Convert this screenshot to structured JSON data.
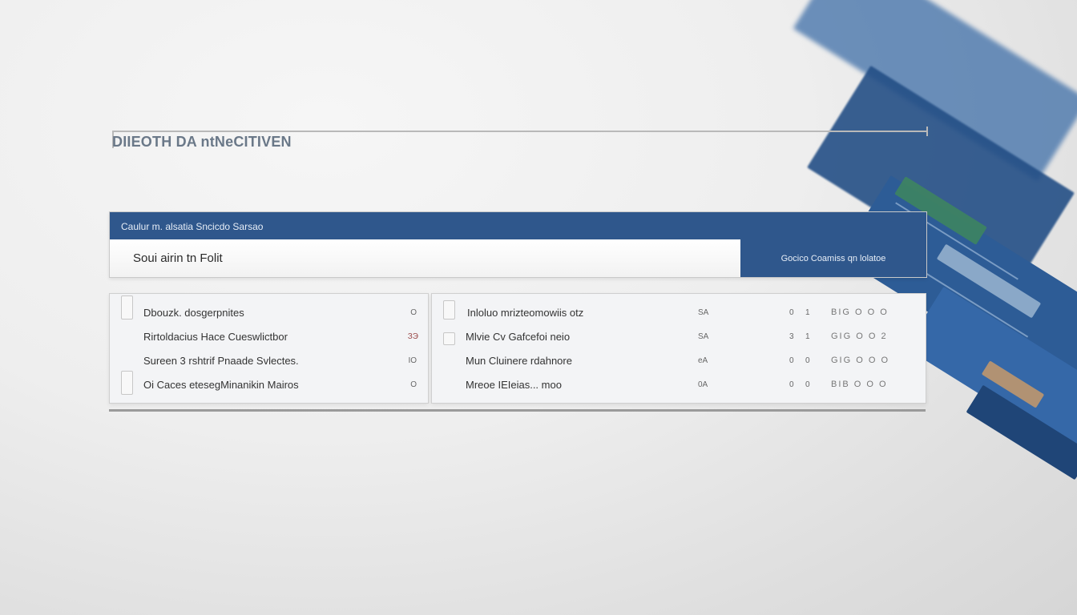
{
  "header": {
    "title": "DIIEOTH DA ntNeCITIVEN"
  },
  "search": {
    "bar_label": "Caulur m. alsatia Sncicdo Sarsao",
    "placeholder": "Soui airin tn Folit",
    "button_label": "Gocico Coamiss qn lolatoe"
  },
  "left_list": {
    "items": [
      {
        "label": "Dbouzk. dosgerpnites",
        "indicator": "O"
      },
      {
        "label": "Rirtoldacius Hace Cueswlictbor",
        "indicator": "ЗЭ"
      },
      {
        "label": "Sureen 3 rshtrif Pnaade Svlectes.",
        "indicator": "IO"
      },
      {
        "label": "Oi Caces etesegMinanikin Mairos",
        "indicator": "O"
      }
    ]
  },
  "right_list": {
    "items": [
      {
        "label": "Inloluo mrizteomowiis otz",
        "col1": "SA",
        "col2": "0",
        "col3": "1",
        "icons": "BIG O O O"
      },
      {
        "label": "Mlvie Cv Gafcefoi neio",
        "col1": "SA",
        "col2": "3",
        "col3": "1",
        "icons": "GIG O O 2"
      },
      {
        "label": "Mun Cluinere rdahnore",
        "col1": "eA",
        "col2": "0",
        "col3": "0",
        "icons": "GIG O O O"
      },
      {
        "label": "Mreoe IEIeias... moo",
        "col1": "0A",
        "col2": "0",
        "col3": "0",
        "icons": "BIB O O O"
      }
    ]
  },
  "colors": {
    "accent": "#2f578c",
    "background": "#eeeeee"
  }
}
